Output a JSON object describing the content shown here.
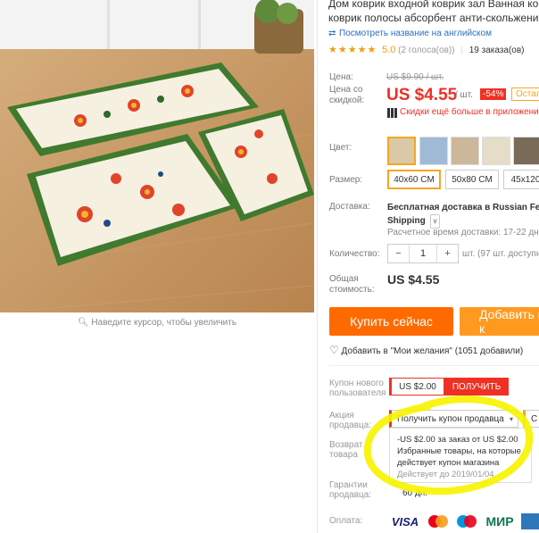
{
  "product": {
    "title_line1": "Дом коврик входной коврик зал Ванная ко",
    "title_line2": "коврик полосы абсорбент анти-скольжени",
    "translate_link": "Посмотреть название на английском",
    "rating_stars": "★★★★★",
    "rating_score": "5.0",
    "rating_votes": "(2 голоса(ов))",
    "orders": "19 заказа(ов)"
  },
  "gallery": {
    "zoom_hint": "Наведите курсор, чтобы увеличить"
  },
  "price": {
    "label_price": "Цена:",
    "original": "US $9.90 / шт.",
    "label_discount_line1": "Цена со",
    "label_discount_line2": "скидкой:",
    "current": "US $4.55",
    "per_unit": "/ шт.",
    "discount_badge": "-54%",
    "remaining_badge": "Остал",
    "app_discount": "Скидки ещё больше в приложени"
  },
  "options": {
    "color_label": "Цвет:",
    "size_label": "Размер:",
    "sizes": [
      "40x60 CM",
      "50x80 CM",
      "45x120"
    ]
  },
  "shipping": {
    "label": "Доставка:",
    "line1": "Бесплатная доставка в Russian Fede",
    "line2": "Shipping",
    "estimate": "Расчетное время доставки: 17-22 дн"
  },
  "quantity": {
    "label": "Количество:",
    "minus": "−",
    "value": "1",
    "plus": "+",
    "available": "шт. (97 шт. доступно)"
  },
  "total": {
    "label_line1": "Общая",
    "label_line2": "стоимость:",
    "value": "US $4.55"
  },
  "actions": {
    "buy_now": "Купить сейчас",
    "add_to_cart": "Добавить в к",
    "wishlist": "Добавить в \"Мои желания\" (1051 добавили)"
  },
  "coupons": {
    "new_user_label_line1": "Купон нового",
    "new_user_label_line2": "пользователя",
    "new_user_amount": "US $2.00",
    "get_button": "ПОЛУЧИТЬ",
    "seller_label_line1": "Акция",
    "seller_label_line2": "продавца:",
    "seller_dropdown": "Получить купон продавца",
    "seller_dropdown2": "С",
    "popup_line1": "-US $2.00 за заказ от US $2.00",
    "popup_line2": "Избранные товары, на которые",
    "popup_line3": "действует купон магазина",
    "popup_valid": "Действует до 2019/01/04"
  },
  "returns": {
    "label_line1": "Возврат",
    "label_line2": "товара"
  },
  "guarantee": {
    "label_line1": "Гарантии",
    "label_line2": "продавца:",
    "days": "60 дн."
  },
  "payment": {
    "label": "Оплата:",
    "visa": "VISA",
    "mir": "МИР"
  },
  "colors": {
    "accent_orange": "#ff6a00",
    "accent_red": "#ef3124",
    "highlight_yellow": "#f7f300"
  }
}
